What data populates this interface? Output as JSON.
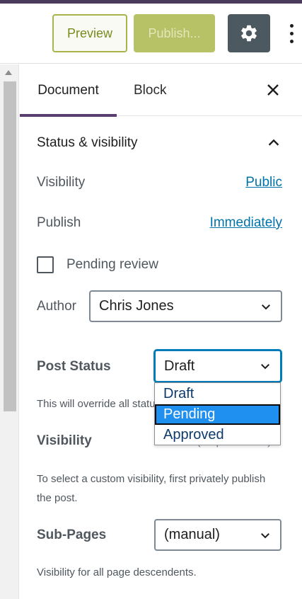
{
  "toolbar": {
    "preview_label": "Preview",
    "publish_label": "Publish...",
    "settings_icon": "gear-icon",
    "more_icon": "more-vertical-icon"
  },
  "sidebar": {
    "tabs": [
      {
        "label": "Document",
        "active": true
      },
      {
        "label": "Block",
        "active": false
      }
    ],
    "close_icon": "close-icon",
    "status_section": {
      "title": "Status & visibility",
      "expanded": true,
      "visibility_label": "Visibility",
      "visibility_value": "Public",
      "publish_label": "Publish",
      "publish_value": "Immediately",
      "pending_review_label": "Pending review",
      "pending_review_checked": false,
      "author_label": "Author",
      "author_value": "Chris Jones",
      "post_status_label": "Post Status",
      "post_status_value": "Draft",
      "post_status_options": [
        "Draft",
        "Pending",
        "Approved"
      ],
      "post_status_highlighted": "Pending",
      "override_help": "This will override all status settings above.",
      "visibility2_label": "Visibility",
      "visibility2_value": "(Unpublished)",
      "visibility2_help": "To select a custom visibility, first privately publish the post.",
      "subpages_label": "Sub-Pages",
      "subpages_value": "(manual)",
      "subpages_help": "Visibility for all page descendents."
    }
  },
  "colors": {
    "accent": "#5a3e6f",
    "link": "#0073aa",
    "publish_button": "#b7c165",
    "settings_button": "#4d5961",
    "option_highlight": "#1f8ff0"
  }
}
